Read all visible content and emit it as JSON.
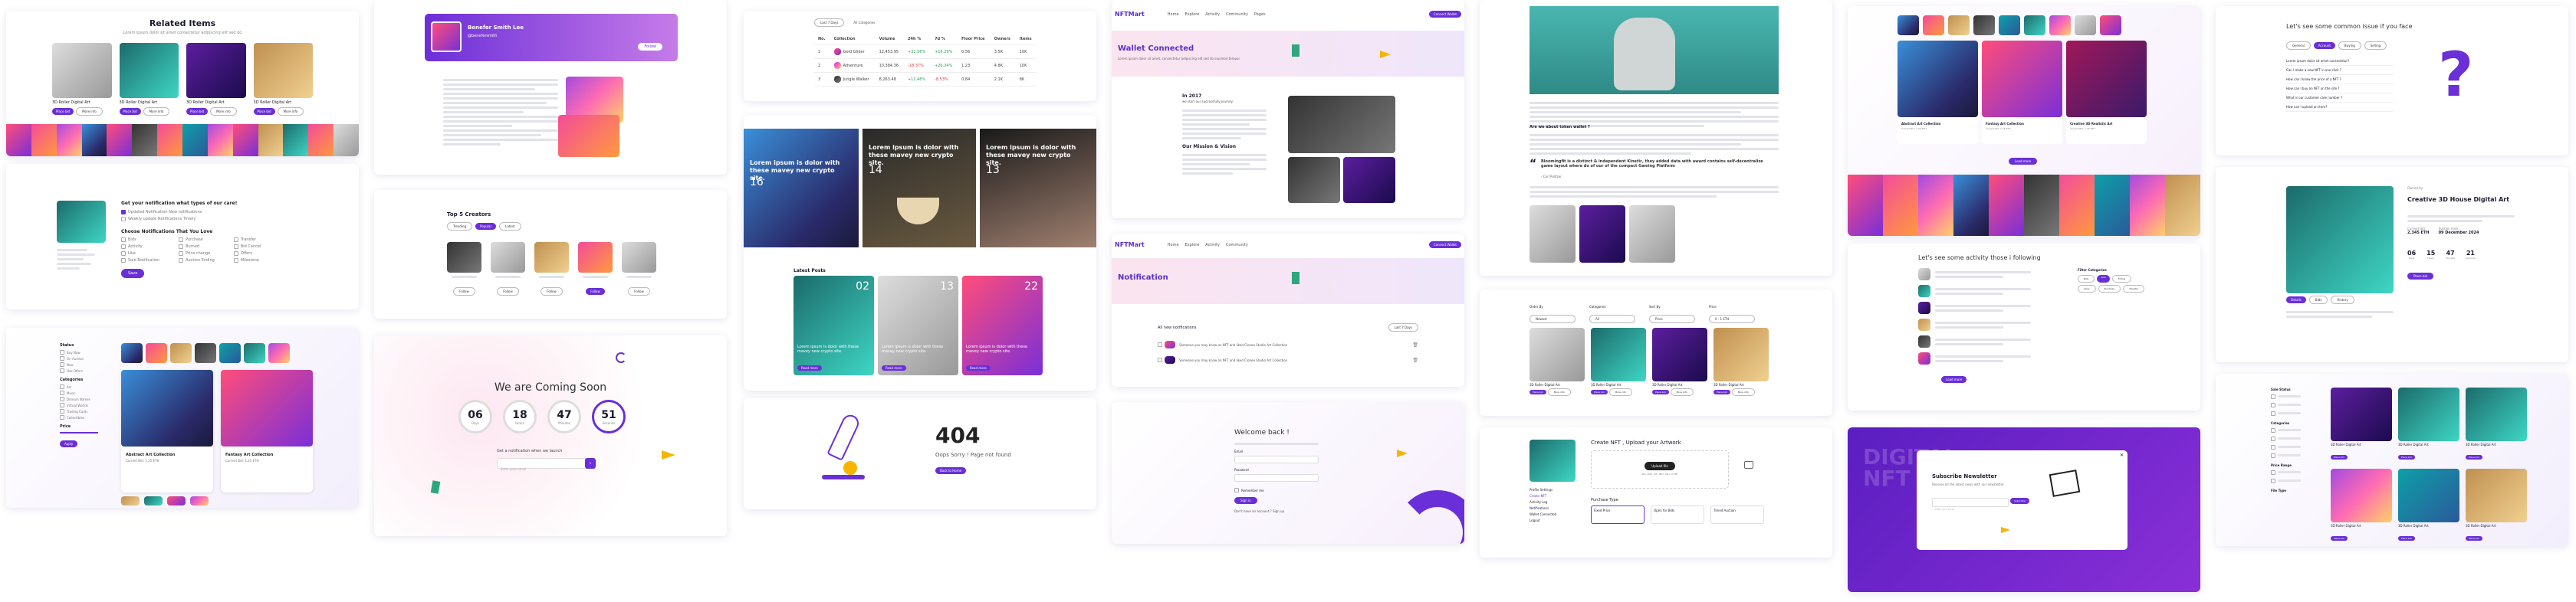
{
  "related": {
    "title": "Related Items",
    "subtitle": "Lorem ipsum dolor sit amet consectetur adipiscing elit sed do",
    "items": [
      {
        "name": "3D Roller Digital Art",
        "bid": "Place bid",
        "more": "More info"
      },
      {
        "name": "3D Roller Digital Art",
        "bid": "Place bid",
        "more": "More info"
      },
      {
        "name": "3D Roller Digital Art",
        "bid": "Place bid",
        "more": "More info"
      },
      {
        "name": "3D Roller Digital Art",
        "bid": "Place bid",
        "more": "More info"
      }
    ]
  },
  "settings": {
    "question": "Get your notification what types of our care!",
    "opt1": "Updated Notification New notifications",
    "opt2": "Weekly update Notifications Timely",
    "choose": "Choose Notifications That You Love",
    "cols": [
      [
        "Bids",
        "Activity",
        "Like",
        "Sold Notification",
        "Outbid",
        "Followers"
      ],
      [
        "Purchase",
        "Burned",
        "Price change",
        "Auction Ending",
        "Deposit",
        "Other"
      ],
      [
        "Transfer",
        "Bid Cancel",
        "Offers",
        "Milestone",
        "Listing",
        "Newsletter"
      ]
    ],
    "save": "Save"
  },
  "profile_banner": {
    "name": "Benefer Smith Lee",
    "handle": "@benefersmith",
    "button": "Follow"
  },
  "creators": {
    "title": "Top 5 Creators",
    "tabs": [
      "Trending",
      "Popular",
      "Latest"
    ],
    "follow": "Follow"
  },
  "coming": {
    "title": "We are Coming Soon",
    "days": "06",
    "hours": "18",
    "mins": "47",
    "secs": "51",
    "lbl": [
      "Days",
      "Hours",
      "Minutes",
      "Seconds"
    ],
    "notify": "Get a notification when we launch",
    "placeholder": "Enter your email",
    "go": "Submit"
  },
  "table": {
    "headers": [
      "No.",
      "Collection",
      "Volume",
      "24h %",
      "7d %",
      "Floor Price",
      "Owners",
      "Items"
    ],
    "rows": [
      [
        "1",
        "Gold Glider",
        "12,453.95",
        "+32.56%",
        "+16.29%",
        "0.56",
        "3.5K",
        "10K"
      ],
      [
        "2",
        "Adventure",
        "10,384.36",
        "-18.37%",
        "+26.34%",
        "1.23",
        "4.8K",
        "10K"
      ],
      [
        "3",
        "Jungle Walker",
        "8,263.48",
        "+12.48%",
        "-8.53%",
        "0.84",
        "2.1K",
        "8K"
      ]
    ]
  },
  "blog": {
    "posts": [
      {
        "date": "16",
        "mon": "Jan",
        "title": "Lorem ipsum is dolor with these mavey new crypto site."
      },
      {
        "date": "14",
        "mon": "Jan",
        "title": "Lorem ipsum is dolor with these mavey new crypto site."
      },
      {
        "date": "13",
        "mon": "Jan",
        "title": "Lorem ipsum is dolor with these mavey new crypto site."
      }
    ],
    "latest": "Latest Posts",
    "small": [
      {
        "date": "02",
        "title": "Lorem ipsum is dolor with these mavey new crypto site."
      },
      {
        "date": "13",
        "title": "Lorem ipsum is dolor with these mavey new crypto site."
      },
      {
        "date": "22",
        "title": "Lorem ipsum is dolor with these mavey new crypto site."
      }
    ],
    "read": "Read more"
  },
  "notfound": {
    "code": "404",
    "msg": "Oops Sorry ! Page not found",
    "btn": "Back to Home"
  },
  "nftmart": {
    "logo": "NFTMart",
    "nav": [
      "Home",
      "Explore",
      "Activity",
      "Community",
      "Pages",
      "Blog",
      "Contact"
    ],
    "btn": "Connect Wallet",
    "wallet": "Wallet Connected",
    "wallet_sub": "Lorem ipsum dolor sit amet, consectetur adipiscing elit sed do eiusmod tempor",
    "in2017": "In 2017",
    "we_set": "we start our successfully journey",
    "mission": "Our Mission & Vision",
    "notification": "Notification",
    "all_notif": "All new notifications",
    "filter": "Last 7 Days",
    "notifs": [
      "Someone you may know on NFT and liked Clonee Studio Art Collection",
      "Someone you may know on NFT and liked Clonee Studio Art Collection"
    ]
  },
  "login": {
    "title": "Welcome back !",
    "email": "Email",
    "password": "Password",
    "remember": "Remember me",
    "signin": "Sign in",
    "signup": "Don't have an account ? Sign up"
  },
  "article": {
    "quote": "Bloomingfit is a distinct & independent Kinetic, they added data with award contains self-decentralize game layout where do of our of the compact Gaming Platform",
    "heading": "Are we about token wallet ?",
    "author": "- Carl Pulitzer"
  },
  "explore_filter": {
    "labels": [
      "Order By",
      "Categories",
      "Sort By",
      "Price"
    ],
    "values": [
      "Newest",
      "All",
      "Price",
      "0 - 1 ETH"
    ],
    "items": [
      "3D Roller Digital Art",
      "3D Roller Digital Art",
      "3D Roller Digital Art",
      "3D Roller Digital Art"
    ],
    "bid": "Place bid",
    "more": "More info"
  },
  "create": {
    "title": "Create NFT , Upload your Artwork",
    "upload": "Upload file",
    "limit": "JPG, PNG, GIF, MP4. Max 10 MB",
    "purchase": "Purchase Type",
    "types": [
      "Fixed Price",
      "Open for Bids",
      "Timed Auction"
    ],
    "menu": [
      "Profile Settings",
      "Create NFT",
      "Activity Log",
      "Notifications",
      "Wallet Connected",
      "Logout"
    ]
  },
  "collections": {
    "items": [
      {
        "name": "Abstract Art Collection",
        "bids": "Current Bid: 1.25 ETH"
      },
      {
        "name": "Fantasy Art Collection",
        "bids": "Current Bid: 1.25 ETH"
      },
      {
        "name": "Creative 3D Realistic Art",
        "bids": "Current Bid: 1.25 ETH"
      }
    ],
    "btn": "Load more"
  },
  "activity": {
    "title": "Let's see some activity those i following",
    "filter": "Filter Categories",
    "tabs": [
      "Bids",
      "Sold",
      "Follow",
      "Likes",
      "Purchase",
      "Transfer"
    ],
    "more": "Load more"
  },
  "newsletter": {
    "title": "Subscribe Newsletter",
    "sub": "Receive all the latest news with our newsletter.",
    "placeholder": "Enter your email",
    "btn": "Subscribe",
    "bg": "DIGITAL NFT"
  },
  "faq": {
    "title": "Let's see some common issue if you face",
    "tabs": [
      "General",
      "Account",
      "Buying",
      "Selling"
    ],
    "questions": [
      "Lorem ipsum dolor sit amet consectetur?",
      "Can I make a new NFT in one click ?",
      "How can I know the price of a NFT ?",
      "How can I buy an NFT on the site ?",
      "What is our customer care number ?",
      "How can I upload an item?"
    ]
  },
  "detail": {
    "title": "Creative 3D House Digital Art",
    "creator": "Owned by",
    "price_lbl": "Current Bid",
    "price": "2.345 ETH",
    "end_lbl": "Auction ends",
    "end": "09 December 2024",
    "countdown": [
      "06",
      "15",
      "47",
      "21"
    ],
    "labels": [
      "Days",
      "Hours",
      "Minutes",
      "Seconds"
    ],
    "tabs": [
      "Details",
      "Bids",
      "History"
    ],
    "bid": "Place bid"
  },
  "market": {
    "filters": [
      "Sale Status",
      "Categories",
      "Price Range",
      "File Type"
    ],
    "items": [
      {
        "name": "3D Roller Digital Art"
      },
      {
        "name": "3D Roller Digital Art"
      },
      {
        "name": "3D Roller Digital Art"
      },
      {
        "name": "3D Roller Digital Art"
      },
      {
        "name": "3D Roller Digital Art"
      },
      {
        "name": "3D Roller Digital Art"
      }
    ],
    "bid": "Place bid"
  },
  "sidebar_filter": {
    "title": "Status",
    "opts": [
      "Buy Now",
      "On Auction",
      "New",
      "Has Offers"
    ],
    "cat": "Categories",
    "cats": [
      "Art",
      "Music",
      "Domain Names",
      "Virtual Worlds",
      "Trading Cards",
      "Collectibles",
      "Sports",
      "Utility"
    ],
    "price": "Price",
    "apply": "Apply"
  },
  "big_cards": [
    {
      "name": "Abstract Art Collection",
      "bid": "Current Bid: 1.25 ETH"
    },
    {
      "name": "Fantasy Art Collection",
      "bid": "Current Bid: 1.25 ETH"
    }
  ]
}
